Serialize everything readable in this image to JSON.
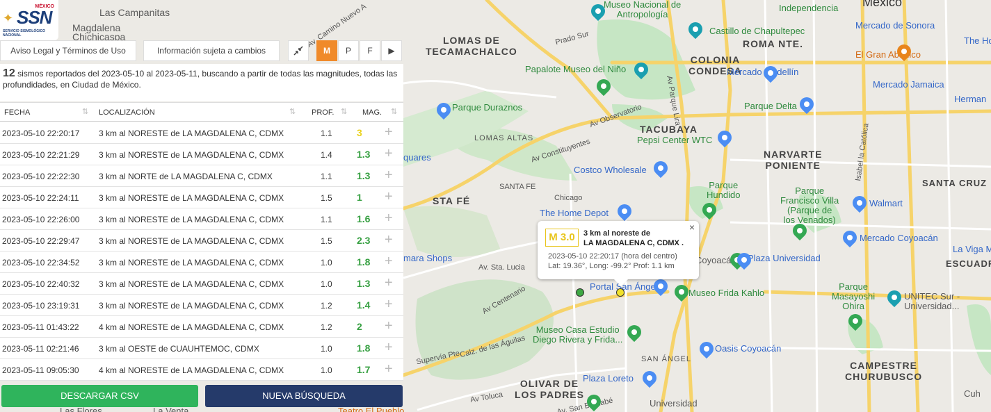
{
  "brand": {
    "country": "MÉXICO",
    "name": "SSN",
    "subtitle": "SERVICIO SISMOLÓGICO NACIONAL"
  },
  "toolbar": {
    "legal": "Aviso Legal y Términos de Uso",
    "notice": "Información sujeta a cambios",
    "collapse_icon": "collapse-icon",
    "m": "M",
    "p": "P",
    "f": "F",
    "play": "▶"
  },
  "summary": {
    "count": "12",
    "text": " sismos reportados del 2023-05-10 al 2023-05-11, buscando a partir de todas las magnitudes, todas las profundidades, en Ciudad de México."
  },
  "table": {
    "headers": {
      "date": "FECHA",
      "loc": "LOCALIZACIÓN",
      "prof": "PROF.",
      "mag": "MAG."
    },
    "rows": [
      {
        "date": "2023-05-10   22:20:17",
        "loc": "3 km al NORESTE de LA MAGDALENA C, CDMX",
        "prof": "1.1",
        "mag": "3"
      },
      {
        "date": "2023-05-10   22:21:29",
        "loc": "3 km al NORESTE de LA MAGDALENA C, CDMX",
        "prof": "1.4",
        "mag": "1.3"
      },
      {
        "date": "2023-05-10   22:22:30",
        "loc": "3 km al NORTE de LA MAGDALENA C, CDMX",
        "prof": "1.1",
        "mag": "1.3"
      },
      {
        "date": "2023-05-10   22:24:11",
        "loc": "3 km al NORESTE de LA MAGDALENA C, CDMX",
        "prof": "1.5",
        "mag": "1"
      },
      {
        "date": "2023-05-10   22:26:00",
        "loc": "3 km al NORESTE de LA MAGDALENA C, CDMX",
        "prof": "1.1",
        "mag": "1.6"
      },
      {
        "date": "2023-05-10   22:29:47",
        "loc": "3 km al NORESTE de LA MAGDALENA C, CDMX",
        "prof": "1.5",
        "mag": "2.3"
      },
      {
        "date": "2023-05-10   22:34:52",
        "loc": "3 km al NORESTE de LA MAGDALENA C, CDMX",
        "prof": "1.0",
        "mag": "1.8"
      },
      {
        "date": "2023-05-10   22:40:32",
        "loc": "3 km al NORESTE de LA MAGDALENA C, CDMX",
        "prof": "1.0",
        "mag": "1.3"
      },
      {
        "date": "2023-05-10   23:19:31",
        "loc": "3 km al NORESTE de LA MAGDALENA C, CDMX",
        "prof": "1.2",
        "mag": "1.4"
      },
      {
        "date": "2023-05-11   01:43:22",
        "loc": "4 km al NORESTE de LA MAGDALENA C, CDMX",
        "prof": "1.2",
        "mag": "2"
      },
      {
        "date": "2023-05-11   02:21:46",
        "loc": "3 km al OESTE de CUAUHTEMOC, CDMX",
        "prof": "1.0",
        "mag": "1.8"
      },
      {
        "date": "2023-05-11   09:05:30",
        "loc": "4 km al NORESTE de LA MAGDALENA C, CDMX",
        "prof": "1.0",
        "mag": "1.7"
      }
    ]
  },
  "buttons": {
    "csv": "DESCARGAR CSV",
    "new_search": "NUEVA BÚSQUEDA"
  },
  "popup": {
    "mag": "M 3.0",
    "place_line1": "3 km al noreste de",
    "place_line2": "LA MAGDALENA C, CDMX .",
    "time": "2023-05-10   22:20:17 (hora del centro)",
    "coords": "Lat: 19.36°, Long: -99.2°  Prof: 1.1 km",
    "close": "×"
  },
  "map_labels": {
    "campanitas": "Las Campanitas",
    "magdalena": "Magdalena",
    "chichicaspa": "Chichicaspa",
    "lomas": "LOMAS DE\nTECAMACHALCO",
    "museo_antro": "Museo Nacional de\nAntropología",
    "castillo": "Castillo de Chapultepec",
    "colonia": "COLONIA\nCONDESA",
    "roma": "ROMA NTE.",
    "independencia": "Independencia",
    "mexico": "México",
    "mercado_sonora": "Mercado de Sonora",
    "the_home": "The Home",
    "abanico": "El Gran Abanico",
    "papalote": "Papalote Museo del Niño",
    "medellin": "Mercado Medellín",
    "jamaica": "Mercado Jamaica",
    "duraznos": "Parque Duraznos",
    "delta": "Parque Delta",
    "herman": "Herman",
    "lomas_altas": "LOMAS ALTAS",
    "tacubaya": "TACUBAYA",
    "pepsi": "Pepsi Center WTC",
    "narvarte": "NARVARTE\nPONIENTE",
    "costco": "Costco Wholesale",
    "santa_fe_small": "SANTA FE",
    "chicago": "Chicago",
    "sta_fe": "STA FÉ",
    "parque_hundido": "Parque\nHundido",
    "parque_venados": "Parque\nFrancisco Villa\n(Parque de\nlos Venados)",
    "santa_cruz": "SANTA CRUZ",
    "walmart": "Walmart",
    "home_depot": "The Home Depot",
    "mercado_coyoacan": "Mercado Coyoacán",
    "la_viga": "La Viga M",
    "escuadron": "ESCUADRO",
    "plaza_univ": "Plaza Universidad",
    "coyoacan": "Coyoacán",
    "mara": "mara Shops",
    "av_sta_lucia": "Av. Sta. Lucia",
    "portal": "Portal San Ángel",
    "frida": "Museo Frida Kahlo",
    "masayoshi": "Parque\nMasayoshi\nOhira",
    "unitec": "UNITEC Sur -\nUniversidad...",
    "museo_casa": "Museo Casa Estudio\nDiego Rivera y Frida...",
    "oasis": "Oasis Coyoacán",
    "san_angel": "SAN ÁNGEL",
    "campestre": "CAMPESTRE\nCHURUBUSCO",
    "olivar": "OLIVAR DE\nLOS PADRES",
    "plaza_loreto": "Plaza Loreto",
    "universidad": "Universidad",
    "la_venta": "La Venta",
    "las_flores": "Las Flores",
    "av_constituyentes": "Av Constituyentes",
    "av_observatorio": "Av Observatorio",
    "prado_sur": "Prado Sur",
    "av_centenario": "Av Centenario",
    "supervia": "Supervía Pte",
    "av_toluca": "Av Toluca",
    "parque_lira": "Av Parque Lira",
    "isabel": "Isabel la Católica",
    "camino": "Av. Camino Nuevo A",
    "aguilas": "Calz. de las Águilas",
    "bernabe": "Av. San Bernabé",
    "uh": "Cuh",
    "squares": "quares",
    "teatro": "Teatro El Pueblo"
  }
}
